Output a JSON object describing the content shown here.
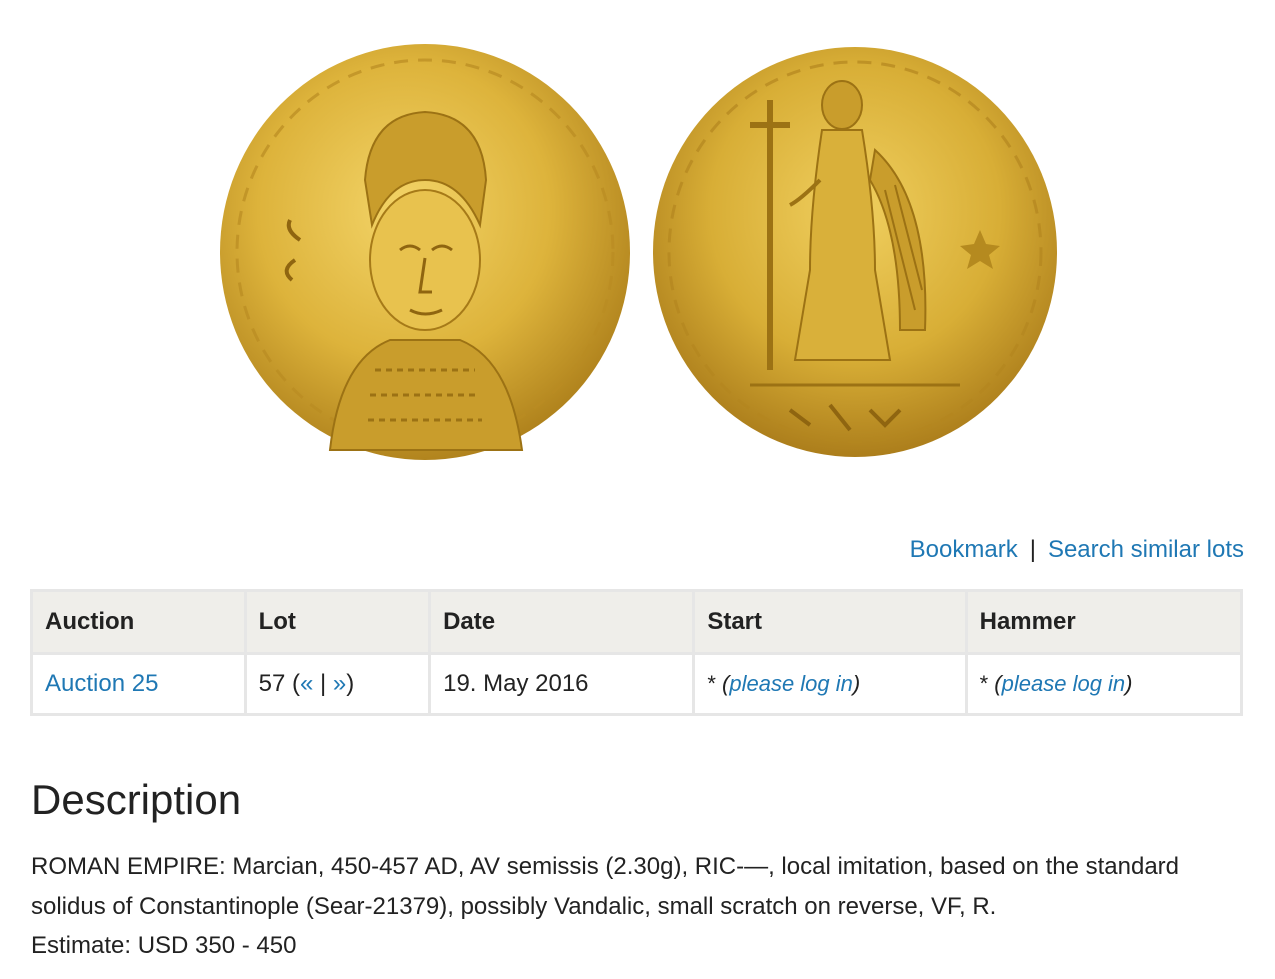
{
  "links": {
    "bookmark": "Bookmark",
    "separator": "|",
    "search_similar": "Search similar lots"
  },
  "table": {
    "headers": [
      "Auction",
      "Lot",
      "Date",
      "Start",
      "Hammer"
    ],
    "auction": "Auction 25",
    "lot_number": "57",
    "lot_prev": "«",
    "lot_sep": "|",
    "lot_next": "»",
    "date": "19. May 2016",
    "start_prefix": "*",
    "start_login": "please log in",
    "hammer_prefix": "*",
    "hammer_login": "please log in"
  },
  "description": {
    "title": "Description",
    "text": "ROMAN EMPIRE: Marcian, 450-457 AD, AV semissis (2.30g), RIC-—, local imitation, based on the standard solidus of Constantinople (Sear-21379), possibly Vandalic, small scratch on reverse, VF, R.",
    "estimate": "Estimate: USD 350 - 450"
  },
  "colors": {
    "link": "#1f78b4",
    "header_bg": "#efeeea",
    "border": "#e6e6e6",
    "gold": "#d9b43c"
  }
}
